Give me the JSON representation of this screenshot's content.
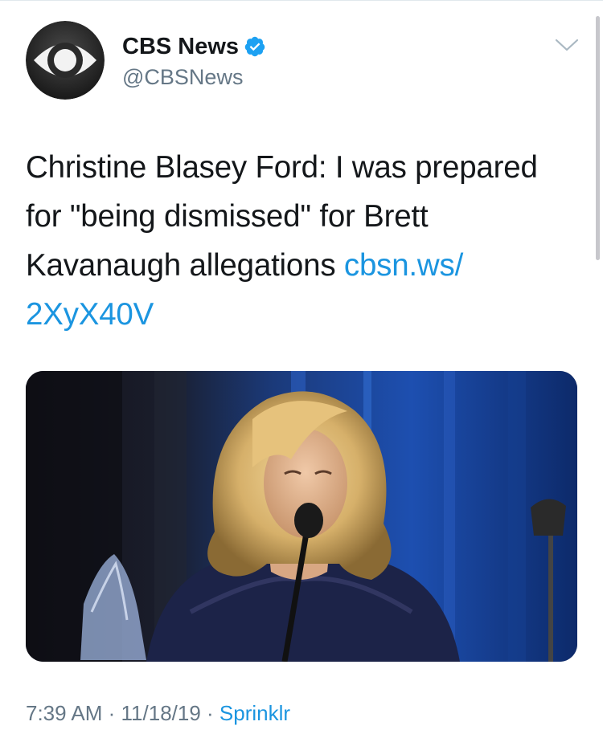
{
  "tweet": {
    "author": {
      "name": "CBS News",
      "handle": "@CBSNews",
      "verified": true,
      "avatar_icon": "cbs-eye-logo"
    },
    "text_lines": [
      "Christine Blasey Ford: I was prepared",
      "for \"being dismissed\" for Brett",
      "Kavanaugh allegations "
    ],
    "link_part1": "cbsn.ws/",
    "link_part2": "2XyX40V",
    "media_description_icon": "photo",
    "time": "7:39 AM",
    "date": "11/18/19",
    "source": "Sprinklr",
    "separator": " · "
  },
  "colors": {
    "text": "#14171a",
    "secondary": "#657786",
    "link": "#1b95e0",
    "verified": "#1da1f2"
  }
}
